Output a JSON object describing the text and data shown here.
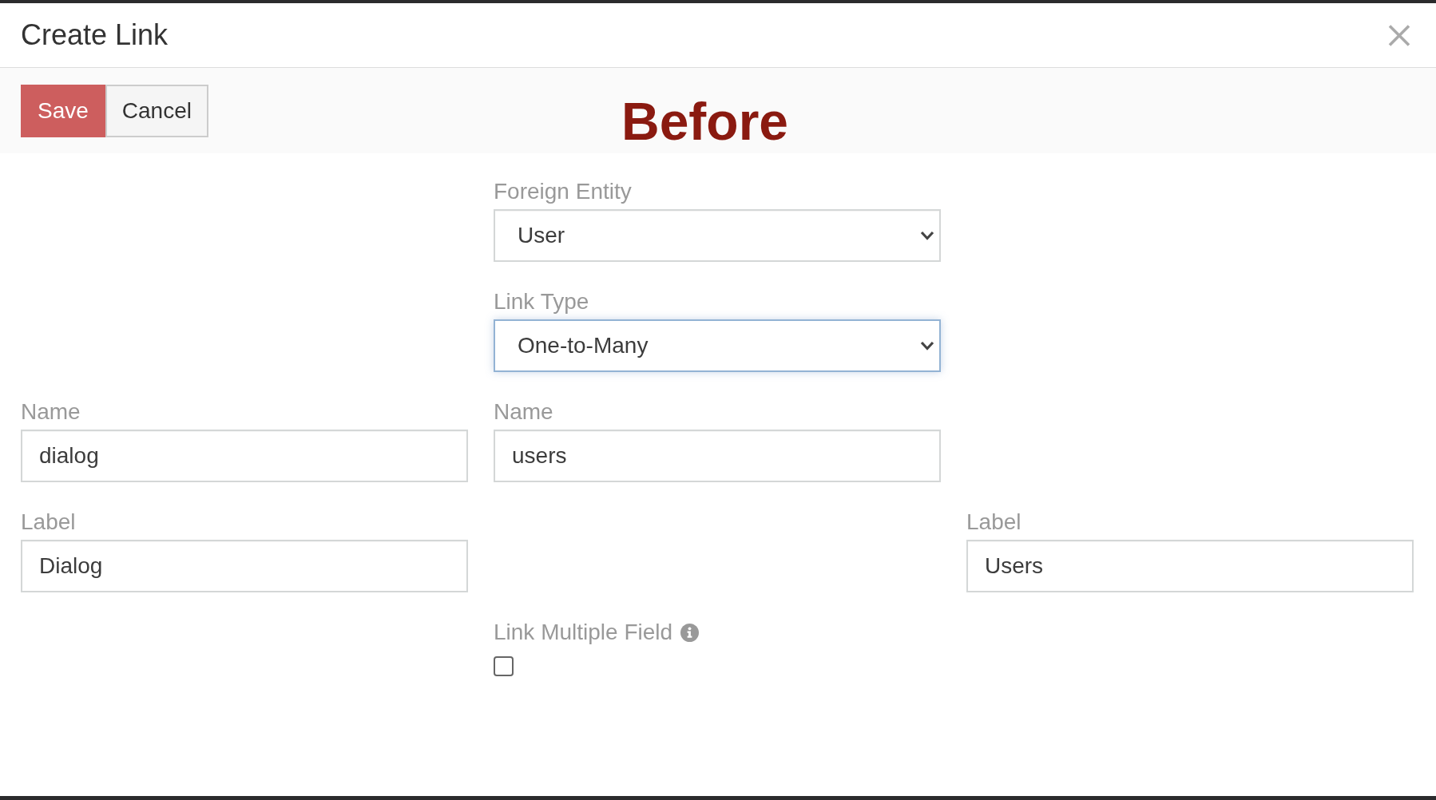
{
  "header": {
    "title": "Create Link"
  },
  "toolbar": {
    "buttons": [
      {
        "label": "Save",
        "kind": "primary"
      },
      {
        "label": "Cancel",
        "kind": "default"
      }
    ],
    "annotation": "Before"
  },
  "form": {
    "rows": [
      {
        "middle": {
          "kind": "select",
          "label": "Foreign Entity",
          "value": "User",
          "focused": false
        }
      },
      {
        "middle": {
          "kind": "select",
          "label": "Link Type",
          "value": "One-to-Many",
          "focused": true
        }
      },
      {
        "left": {
          "kind": "text",
          "label": "Name",
          "value": "dialog",
          "focused": false
        },
        "middle": {
          "kind": "text",
          "label": "Name",
          "value": "users",
          "focused": false
        }
      },
      {
        "left": {
          "kind": "text",
          "label": "Label",
          "value": "Dialog",
          "focused": false
        },
        "right": {
          "kind": "text",
          "label": "Label",
          "value": "Users",
          "focused": false
        }
      },
      {
        "middle": {
          "kind": "checkbox",
          "label": "Link Multiple Field",
          "info": true,
          "checked": false
        }
      }
    ]
  }
}
